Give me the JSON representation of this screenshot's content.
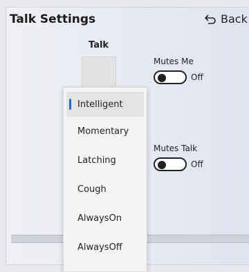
{
  "header": {
    "title": "Talk Settings",
    "back_label": "Back"
  },
  "talk": {
    "label": "Talk"
  },
  "mutes_me": {
    "label": "Mutes Me",
    "state": "Off"
  },
  "mutes_talk": {
    "label": "Mutes Talk",
    "state": "Off"
  },
  "dropdown": {
    "options": [
      "Intelligent",
      "Momentary",
      "Latching",
      "Cough",
      "AlwaysOn",
      "AlwaysOff"
    ],
    "selected": "Intelligent"
  },
  "colors": {
    "accent": "#1f6fd1"
  }
}
